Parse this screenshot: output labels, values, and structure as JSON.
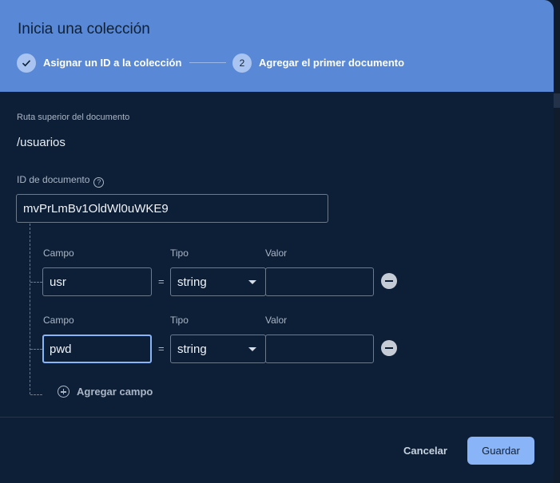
{
  "dialog": {
    "title": "Inicia una colección",
    "steps": [
      {
        "marker": "✓",
        "label": "Asignar un ID a la colección",
        "status": "done"
      },
      {
        "marker": "2",
        "label": "Agregar el primer documento",
        "status": "active"
      }
    ]
  },
  "parent_path": {
    "label": "Ruta superior del documento",
    "value": "/usuarios"
  },
  "document_id": {
    "label": "ID de documento",
    "help_icon": "help-circle-icon",
    "value": "mvPrLmBv1OldWl0uWKE9"
  },
  "fields": [
    {
      "campo_label": "Campo",
      "tipo_label": "Tipo",
      "valor_label": "Valor",
      "name": "usr",
      "equals": "=",
      "type": "string",
      "value": ""
    },
    {
      "campo_label": "Campo",
      "tipo_label": "Tipo",
      "valor_label": "Valor",
      "name": "pwd",
      "equals": "=",
      "type": "string",
      "value": ""
    }
  ],
  "add_field_label": "Agregar campo",
  "buttons": {
    "cancel": "Cancelar",
    "save": "Guardar"
  },
  "colors": {
    "header": "#5888d6",
    "body": "#0d1f36",
    "accent": "#8ab4f8"
  }
}
